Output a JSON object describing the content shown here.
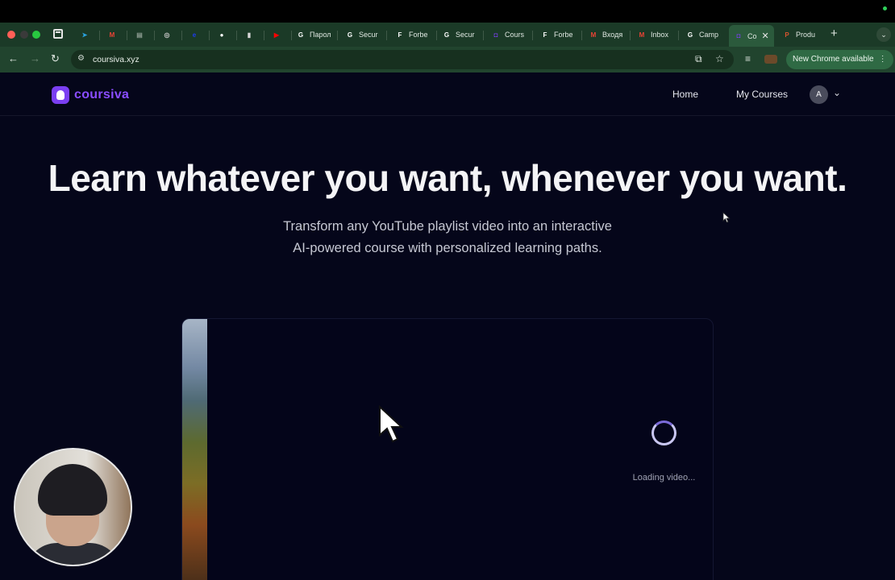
{
  "browser": {
    "tabs": [
      {
        "label": "",
        "icon": "telegram-icon",
        "color": "#2aa3e0",
        "glyph": "➤"
      },
      {
        "label": "",
        "icon": "gmail-icon",
        "color": "#ea4335",
        "glyph": "M"
      },
      {
        "label": "",
        "icon": "sheets-icon",
        "color": "#8a9a8f",
        "glyph": "▤"
      },
      {
        "label": "",
        "icon": "openai-icon",
        "color": "#c8c8c8",
        "glyph": "◎"
      },
      {
        "label": "",
        "icon": "e-icon",
        "color": "#1d3cf0",
        "glyph": "e"
      },
      {
        "label": "",
        "icon": "github-icon",
        "color": "#ffffff",
        "glyph": "●"
      },
      {
        "label": "",
        "icon": "doc-icon",
        "color": "#d8d8d8",
        "glyph": "▮"
      },
      {
        "label": "",
        "icon": "youtube-icon",
        "color": "#ff0000",
        "glyph": "▶"
      },
      {
        "label": "Парол",
        "icon": "google-icon",
        "color": "#ffffff",
        "glyph": "G"
      },
      {
        "label": "Secur",
        "icon": "google-icon",
        "color": "#ffffff",
        "glyph": "G"
      },
      {
        "label": "Forbe",
        "icon": "forbes-icon",
        "color": "#ffffff",
        "glyph": "F"
      },
      {
        "label": "Secur",
        "icon": "google-icon",
        "color": "#ffffff",
        "glyph": "G"
      },
      {
        "label": "Cours",
        "icon": "coursiva-icon",
        "color": "#7b3ff2",
        "glyph": "◘"
      },
      {
        "label": "Forbe",
        "icon": "forbes-icon",
        "color": "#ffffff",
        "glyph": "F"
      },
      {
        "label": "Входя",
        "icon": "gmail-icon",
        "color": "#ea4335",
        "glyph": "M"
      },
      {
        "label": "Inbox",
        "icon": "gmail-icon",
        "color": "#ea4335",
        "glyph": "M"
      },
      {
        "label": "Camp",
        "icon": "google-icon",
        "color": "#ffffff",
        "glyph": "G"
      },
      {
        "label": "Co",
        "icon": "coursiva-icon",
        "color": "#7b3ff2",
        "glyph": "◘",
        "active": true
      },
      {
        "label": "Produ",
        "icon": "producthunt-icon",
        "color": "#da552f",
        "glyph": "P"
      }
    ],
    "url": "coursiva.xyz",
    "update_label": "New Chrome available",
    "new_tab": "+",
    "tab_search": "⌄"
  },
  "site": {
    "logo_text": "coursiva",
    "nav": {
      "home": "Home",
      "my_courses": "My Courses",
      "avatar_initial": "A"
    },
    "hero": {
      "title": "Learn whatever you want, whenever you want.",
      "subtitle": "Transform any YouTube playlist video into an interactive AI-powered course with personalized learning paths."
    },
    "video": {
      "loading_text": "Loading video..."
    }
  }
}
